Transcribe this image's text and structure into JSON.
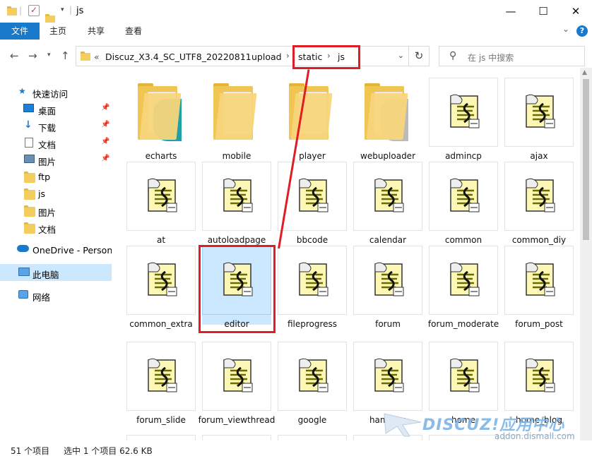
{
  "window": {
    "title": "js",
    "controls": {
      "minimize": "—",
      "maximize": "☐",
      "close": "✕"
    }
  },
  "ribbon": {
    "tabs": [
      "文件",
      "主页",
      "共享",
      "查看"
    ],
    "chevron": "⌄",
    "help": "?"
  },
  "nav": {
    "breadcrumb_prefix": "«",
    "path": [
      "Discuz_X3.4_SC_UTF8_20220811",
      "upload",
      "static",
      "js"
    ],
    "search_placeholder": "在 js 中搜索"
  },
  "sidebar": {
    "items": [
      {
        "label": "快速访问",
        "icon": "star-icon",
        "pinned": false
      },
      {
        "label": "桌面",
        "icon": "desktop-icon",
        "pinned": true
      },
      {
        "label": "下载",
        "icon": "download-icon",
        "pinned": true
      },
      {
        "label": "文档",
        "icon": "document-icon",
        "pinned": true
      },
      {
        "label": "图片",
        "icon": "picture-icon",
        "pinned": true
      },
      {
        "label": "ftp",
        "icon": "folder-icon",
        "pinned": false
      },
      {
        "label": "js",
        "icon": "folder-icon",
        "pinned": false
      },
      {
        "label": "图片",
        "icon": "folder-icon",
        "pinned": false
      },
      {
        "label": "文档",
        "icon": "folder-icon",
        "pinned": false
      },
      {
        "label": "OneDrive - Persona",
        "icon": "onedrive-icon",
        "pinned": false
      },
      {
        "label": "此电脑",
        "icon": "computer-icon",
        "pinned": false,
        "selected": true
      },
      {
        "label": "网络",
        "icon": "network-icon",
        "pinned": false
      }
    ]
  },
  "files": [
    {
      "name": "echarts",
      "type": "folder",
      "badge": "#20a0a8"
    },
    {
      "name": "mobile",
      "type": "folder",
      "badge": ""
    },
    {
      "name": "player",
      "type": "folder",
      "badge": ""
    },
    {
      "name": "webuploader",
      "type": "folder",
      "badge": "#bbbbbb"
    },
    {
      "name": "admincp",
      "type": "script"
    },
    {
      "name": "ajax",
      "type": "script"
    },
    {
      "name": "at",
      "type": "script"
    },
    {
      "name": "autoloadpage",
      "type": "script"
    },
    {
      "name": "bbcode",
      "type": "script"
    },
    {
      "name": "calendar",
      "type": "script"
    },
    {
      "name": "common",
      "type": "script"
    },
    {
      "name": "common_diy",
      "type": "script"
    },
    {
      "name": "common_extra",
      "type": "script"
    },
    {
      "name": "editor",
      "type": "script",
      "selected": true
    },
    {
      "name": "fileprogress",
      "type": "script"
    },
    {
      "name": "forum",
      "type": "script"
    },
    {
      "name": "forum_moderate",
      "type": "script"
    },
    {
      "name": "forum_post",
      "type": "script"
    },
    {
      "name": "forum_slide",
      "type": "script"
    },
    {
      "name": "forum_viewthread",
      "type": "script"
    },
    {
      "name": "google",
      "type": "script"
    },
    {
      "name": "handlers",
      "type": "script"
    },
    {
      "name": "home",
      "type": "script"
    },
    {
      "name": "home_blog",
      "type": "script"
    }
  ],
  "status": {
    "count": "51 个项目",
    "selection": "选中 1 个项目  62.6 KB"
  },
  "watermark": {
    "logo": "DISCUZ!应用中心",
    "url": "addon.dismall.com"
  },
  "colors": {
    "accent": "#1979ca",
    "selection": "#cce8ff",
    "annotation": "#e01d24"
  }
}
